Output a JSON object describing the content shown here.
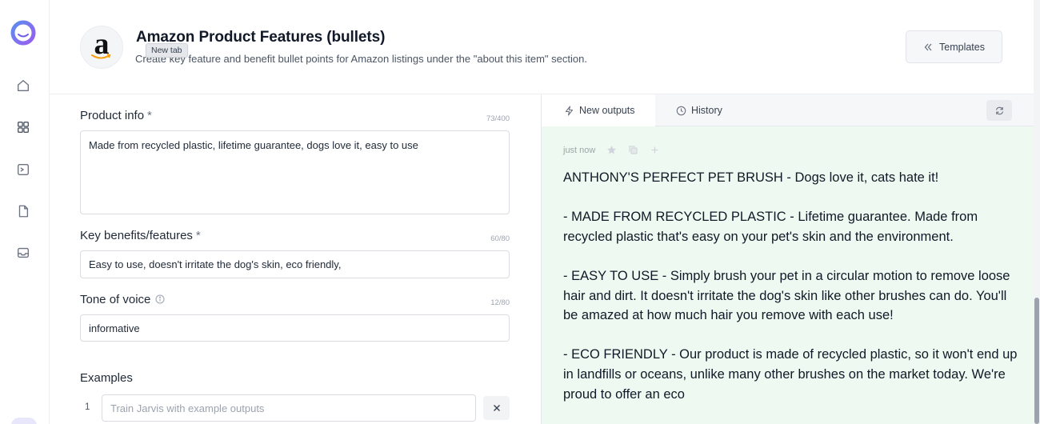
{
  "header": {
    "title": "Amazon Product Features (bullets)",
    "subtitle": "Create key feature and benefit bullet points for Amazon listings under the \"about this item\" section.",
    "tooltip": "New tab",
    "templates_label": "Templates"
  },
  "form": {
    "product_info": {
      "label": "Product info",
      "required": "*",
      "count": "73/400",
      "value": "Made from recycled plastic, lifetime guarantee, dogs love it, easy to use"
    },
    "key_benefits": {
      "label": "Key benefits/features",
      "required": "*",
      "count": "60/80",
      "value": "Easy to use, doesn't irritate the dog's skin, eco friendly,"
    },
    "tone": {
      "label": "Tone of voice",
      "count": "12/80",
      "value": "informative"
    },
    "examples": {
      "label": "Examples",
      "number": "1",
      "placeholder": "Train Jarvis with example outputs"
    }
  },
  "output": {
    "tabs": [
      {
        "label": "New outputs"
      },
      {
        "label": "History"
      }
    ],
    "timestamp": "just now",
    "paragraphs": [
      "ANTHONY'S PERFECT PET BRUSH - Dogs love it, cats hate it!",
      "- MADE FROM RECYCLED PLASTIC - Lifetime guarantee. Made from recycled plastic that's easy on your pet's skin and the environment.",
      "- EASY TO USE - Simply brush your pet in a circular motion to remove loose hair and dirt. It doesn't irritate the dog's skin like other brushes can do. You'll be amazed at how much hair you remove with each use!",
      "- ECO FRIENDLY - Our product is made of recycled plastic, so it won't end up in landfills or oceans, unlike many other brushes on the market today. We're proud to offer an eco"
    ]
  },
  "colors": {
    "brand_purple": "#7c6cf0",
    "output_bg": "#eefaf1",
    "border": "#d9dce1"
  },
  "icons": {
    "rail": [
      "home-icon",
      "grid-icon",
      "terminal-icon",
      "document-icon",
      "inbox-icon"
    ],
    "tabs": [
      "bolt-icon",
      "clock-icon"
    ],
    "meta": [
      "star-icon",
      "copy-icon",
      "plus-icon"
    ]
  }
}
